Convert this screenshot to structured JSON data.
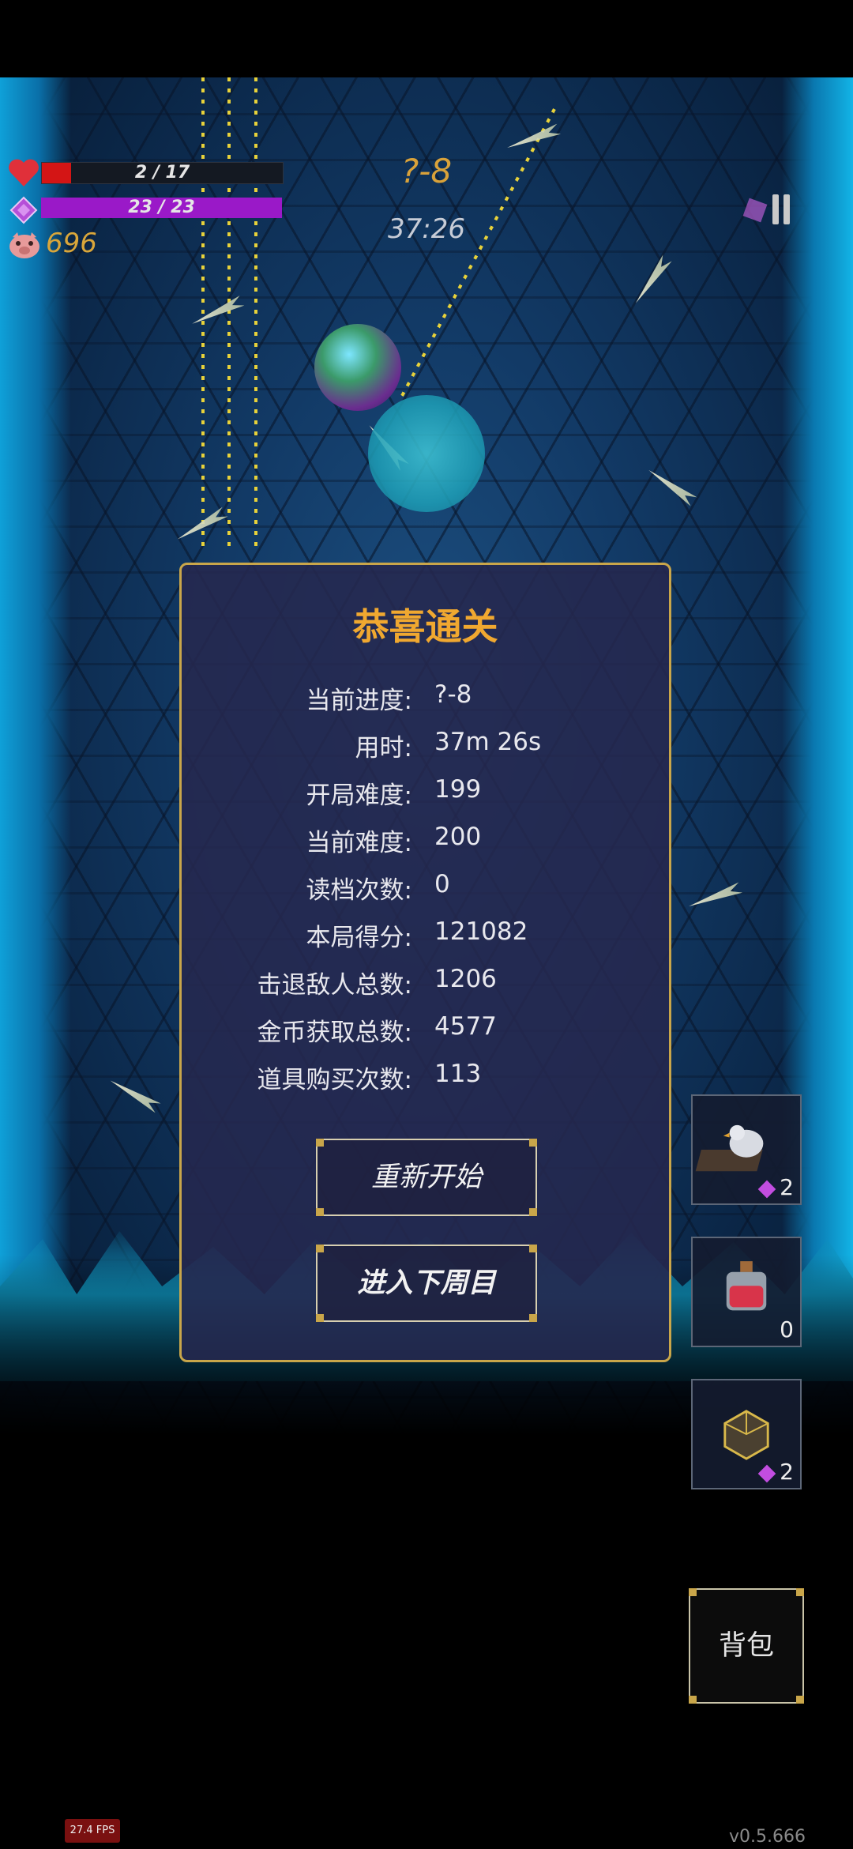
{
  "hud": {
    "hp_text": "2 / 17",
    "hp_fraction": 0.12,
    "mp_text": "23 / 23",
    "mp_fraction": 1.0,
    "coins": "696",
    "stage": "?-8",
    "timer": "37:26"
  },
  "dialog": {
    "title": "恭喜通关",
    "stats": [
      {
        "label": "当前进度:",
        "value": "?-8"
      },
      {
        "label": "用时:",
        "value": "37m 26s"
      },
      {
        "label": "开局难度:",
        "value": "199"
      },
      {
        "label": "当前难度:",
        "value": "200"
      },
      {
        "label": "读档次数:",
        "value": "0"
      },
      {
        "label": "本局得分:",
        "value": "121082"
      },
      {
        "label": "击退敌人总数:",
        "value": "1206"
      },
      {
        "label": "金币获取总数:",
        "value": "4577"
      },
      {
        "label": "道具购买次数:",
        "value": "113"
      }
    ],
    "restart_label": "重新开始",
    "next_cycle_label": "进入下周目"
  },
  "items": [
    {
      "icon": "bird-figure-icon",
      "count": "2",
      "cost_gem": true
    },
    {
      "icon": "red-potion-icon",
      "count": "0",
      "cost_gem": false
    },
    {
      "icon": "icosahedron-icon",
      "count": "2",
      "cost_gem": true
    }
  ],
  "bag_label": "背包",
  "fps": "27.4 FPS",
  "version": "v0.5.666",
  "colors": {
    "accent_gold": "#c9a64a",
    "title_orange": "#f0a830",
    "hp_red": "#d41515",
    "mp_purple": "#9a19c8"
  }
}
